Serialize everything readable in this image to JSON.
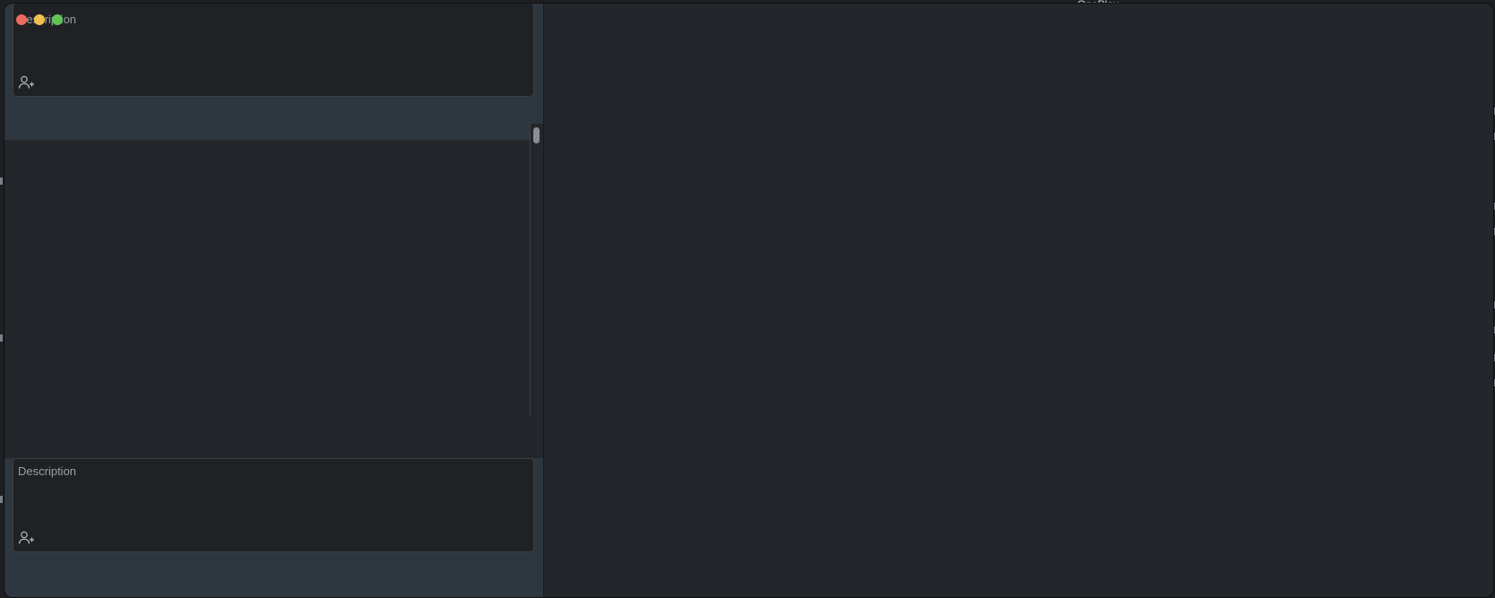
{
  "window": {
    "controls": [
      "close",
      "minimize",
      "zoom"
    ],
    "background_peek_text": "OnePlay"
  },
  "cards": [
    {
      "label": "Description",
      "icon": "add-person-icon"
    },
    {
      "label": "Description",
      "icon": "add-person-icon"
    }
  ],
  "colors": {
    "sidebar": "#2e363f",
    "content": "#23272b",
    "card": "#1f2125",
    "close": "#ed6a5e",
    "minimize": "#f5bf4f",
    "zoom": "#61c554"
  }
}
